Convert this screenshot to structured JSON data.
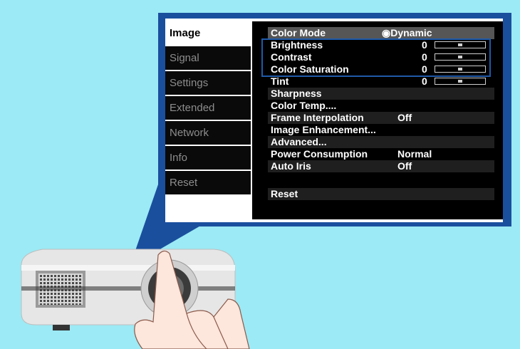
{
  "sidebar": {
    "items": [
      {
        "label": "Image",
        "active": true
      },
      {
        "label": "Signal"
      },
      {
        "label": "Settings"
      },
      {
        "label": "Extended"
      },
      {
        "label": "Network"
      },
      {
        "label": "Info"
      },
      {
        "label": "Reset"
      }
    ]
  },
  "panel": {
    "color_mode": {
      "label": "Color Mode",
      "value": "Dynamic",
      "icon": "dynamic-mode-icon"
    },
    "brightness": {
      "label": "Brightness",
      "value": "0",
      "level": 0.5
    },
    "contrast": {
      "label": "Contrast",
      "value": "0",
      "level": 0.5
    },
    "color_saturation": {
      "label": "Color Saturation",
      "value": "0",
      "level": 0.5
    },
    "tint": {
      "label": "Tint",
      "value": "0",
      "level": 0.5
    },
    "sharpness": {
      "label": "Sharpness"
    },
    "color_temp": {
      "label": "Color Temp...."
    },
    "frame_interpolation": {
      "label": "Frame Interpolation",
      "value": "Off"
    },
    "image_enhancement": {
      "label": "Image Enhancement..."
    },
    "advanced": {
      "label": "Advanced..."
    },
    "power_consumption": {
      "label": "Power Consumption",
      "value": "Normal"
    },
    "auto_iris": {
      "label": "Auto Iris",
      "value": "Off"
    },
    "reset": {
      "label": "Reset"
    }
  },
  "colors": {
    "background": "#9ceaf5",
    "frame": "#1a4f9e",
    "highlight_box": "#1f5aa9"
  }
}
